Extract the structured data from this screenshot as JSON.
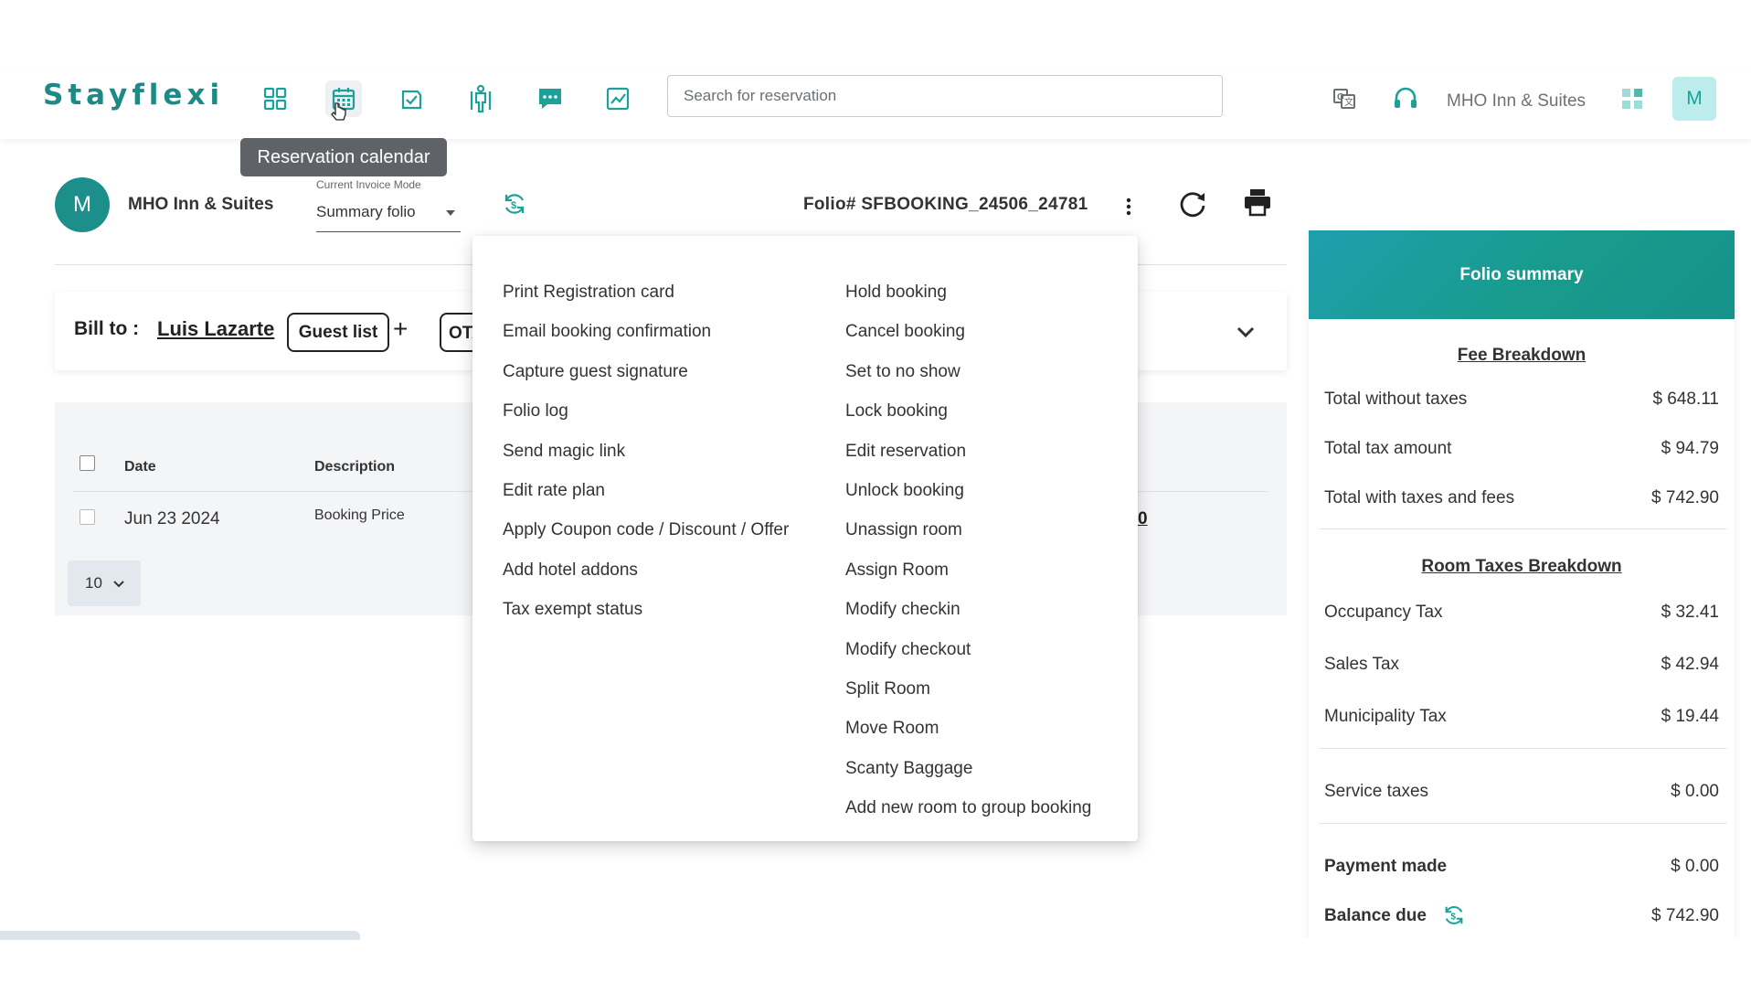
{
  "app": {
    "logo": "Stayflexi",
    "search_placeholder": "Search for reservation",
    "hotel_name_top": "MHO Inn & Suites",
    "avatar_initial": "M",
    "tooltip": "Reservation calendar",
    "nav_icons": [
      "dashboard-icon",
      "calendar-icon",
      "checkin-icon",
      "housekeeping-icon",
      "messages-icon",
      "reports-icon"
    ],
    "right_icons": [
      "translate-icon",
      "headset-icon",
      "apps-grid-icon"
    ]
  },
  "header": {
    "avatar_initial": "M",
    "hotel_name": "MHO Inn & Suites",
    "invoice_mode_label": "Current Invoice Mode",
    "invoice_mode_value": "Summary folio",
    "folio_number": "Folio# SFBOOKING_24506_24781"
  },
  "billto": {
    "label": "Bill to :",
    "guest_name": "Luis Lazarte",
    "guest_list_button": "Guest list",
    "add_button": "+",
    "ota_button": "OTA"
  },
  "table": {
    "columns": [
      "Date",
      "Description"
    ],
    "truncated_column": ")",
    "rows": [
      {
        "date": "Jun 23 2024",
        "description": "Booking Price",
        "amount_fragment": "0"
      }
    ],
    "page_size": "10"
  },
  "menu": {
    "left": [
      "Print Registration card",
      "Email booking confirmation",
      "Capture guest signature",
      "Folio log",
      "Send magic link",
      "Edit rate plan",
      "Apply Coupon code / Discount / Offer",
      "Add hotel addons",
      "Tax exempt status"
    ],
    "right": [
      "Hold booking",
      "Cancel booking",
      "Set to no show",
      "Lock booking",
      "Edit reservation",
      "Unlock booking",
      "Unassign room",
      "Assign Room",
      "Modify checkin",
      "Modify checkout",
      "Split Room",
      "Move Room",
      "Scanty Baggage",
      "Add new room to group booking"
    ]
  },
  "summary": {
    "title": "Folio summary",
    "fee_breakdown_title": "Fee Breakdown",
    "fees": [
      {
        "label": "Total without taxes",
        "value": "$ 648.11"
      },
      {
        "label": "Total tax amount",
        "value": "$ 94.79"
      },
      {
        "label": "Total with taxes and fees",
        "value": "$ 742.90"
      }
    ],
    "room_taxes_title": "Room Taxes Breakdown",
    "taxes": [
      {
        "label": "Occupancy Tax",
        "value": "$ 32.41"
      },
      {
        "label": "Sales Tax",
        "value": "$ 42.94"
      },
      {
        "label": "Municipality Tax",
        "value": "$ 19.44"
      }
    ],
    "service_taxes": {
      "label": "Service taxes",
      "value": "$ 0.00"
    },
    "payment_made": {
      "label": "Payment made",
      "value": "$ 0.00"
    },
    "balance_due": {
      "label": "Balance due",
      "value": "$ 742.90"
    }
  },
  "colors": {
    "brand_teal": "#1d8f8a",
    "summary_header": "#189b8c",
    "nav_icon": "#1aa19a"
  }
}
